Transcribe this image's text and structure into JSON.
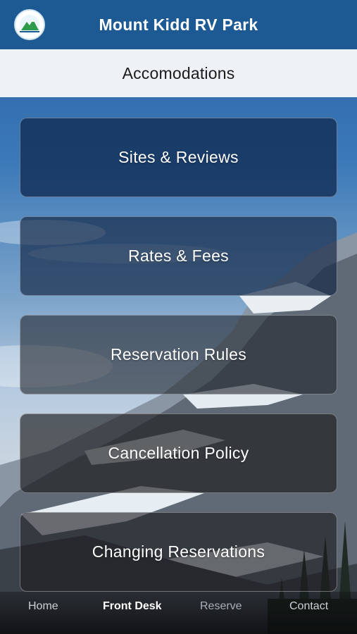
{
  "header": {
    "title": "Mount Kidd RV Park",
    "logo_icon": "mountain-logo-icon"
  },
  "subheader": {
    "title": "Accomodations"
  },
  "menu": [
    {
      "label": "Sites & Reviews"
    },
    {
      "label": "Rates & Fees"
    },
    {
      "label": "Reservation Rules"
    },
    {
      "label": "Cancellation Policy"
    },
    {
      "label": "Changing Reservations"
    }
  ],
  "tabs": [
    {
      "label": "Home",
      "active": false
    },
    {
      "label": "Front Desk",
      "active": true
    },
    {
      "label": "Reserve",
      "active": false
    },
    {
      "label": "Contact",
      "active": false
    }
  ],
  "colors": {
    "header_bg": "#1d5a94",
    "subheader_bg": "#eef1f5",
    "accent_green": "#2e9b4a"
  }
}
